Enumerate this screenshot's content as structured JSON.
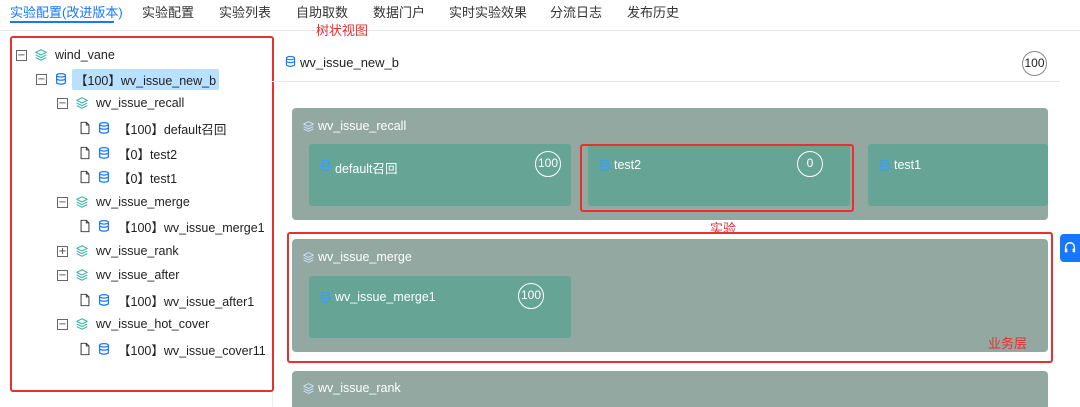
{
  "tabs": [
    {
      "label": "实验配置(改进版本)",
      "active": true
    },
    {
      "label": "实验配置"
    },
    {
      "label": "实验列表"
    },
    {
      "label": "自助取数"
    },
    {
      "label": "数据门户"
    },
    {
      "label": "实时实验效果"
    },
    {
      "label": "分流日志"
    },
    {
      "label": "发布历史"
    }
  ],
  "annotations": {
    "tree_view": "树状视图",
    "experiment": "实验",
    "business_layer": "业务层"
  },
  "tree": [
    {
      "label": "wind_vane",
      "toggle": "−",
      "icon": "layers-icon"
    },
    {
      "label": "【100】wv_issue_new_b",
      "toggle": "−",
      "icon": "bucket-icon",
      "selected": true
    },
    {
      "label": "wv_issue_recall",
      "toggle": "−",
      "icon": "layers-icon"
    },
    {
      "label": "【100】default召回",
      "icon": "bucket-icon",
      "leaf": true
    },
    {
      "label": "【0】test2",
      "icon": "bucket-icon",
      "leaf": true
    },
    {
      "label": "【0】test1",
      "icon": "bucket-icon",
      "leaf": true
    },
    {
      "label": "wv_issue_merge",
      "toggle": "−",
      "icon": "layers-icon"
    },
    {
      "label": "【100】wv_issue_merge1",
      "icon": "bucket-icon",
      "leaf": true
    },
    {
      "label": "wv_issue_rank",
      "toggle": "+",
      "icon": "layers-icon"
    },
    {
      "label": "wv_issue_after",
      "toggle": "−",
      "icon": "layers-icon"
    },
    {
      "label": "【100】wv_issue_after1",
      "icon": "bucket-icon",
      "leaf": true
    },
    {
      "label": "wv_issue_hot_cover",
      "toggle": "−",
      "icon": "layers-icon"
    },
    {
      "label": "【100】wv_issue_cover11",
      "icon": "bucket-icon",
      "leaf": true
    }
  ],
  "header": {
    "title": "wv_issue_new_b",
    "badge": "100"
  },
  "layers": [
    {
      "title": "wv_issue_recall",
      "experiments": [
        {
          "title": "default召回",
          "badge": "100"
        },
        {
          "title": "test2",
          "badge": "0"
        },
        {
          "title": "test1",
          "badge": ""
        }
      ]
    },
    {
      "title": "wv_issue_merge",
      "experiments": [
        {
          "title": "wv_issue_merge1",
          "badge": "100"
        }
      ]
    },
    {
      "title": "wv_issue_rank",
      "experiments": []
    }
  ],
  "colors": {
    "accent": "#1677ff",
    "annotation": "#e8302e",
    "layer_bg": "#93a8a1",
    "experiment_bg": "#66a596",
    "selected_bg": "#bae0ff"
  }
}
